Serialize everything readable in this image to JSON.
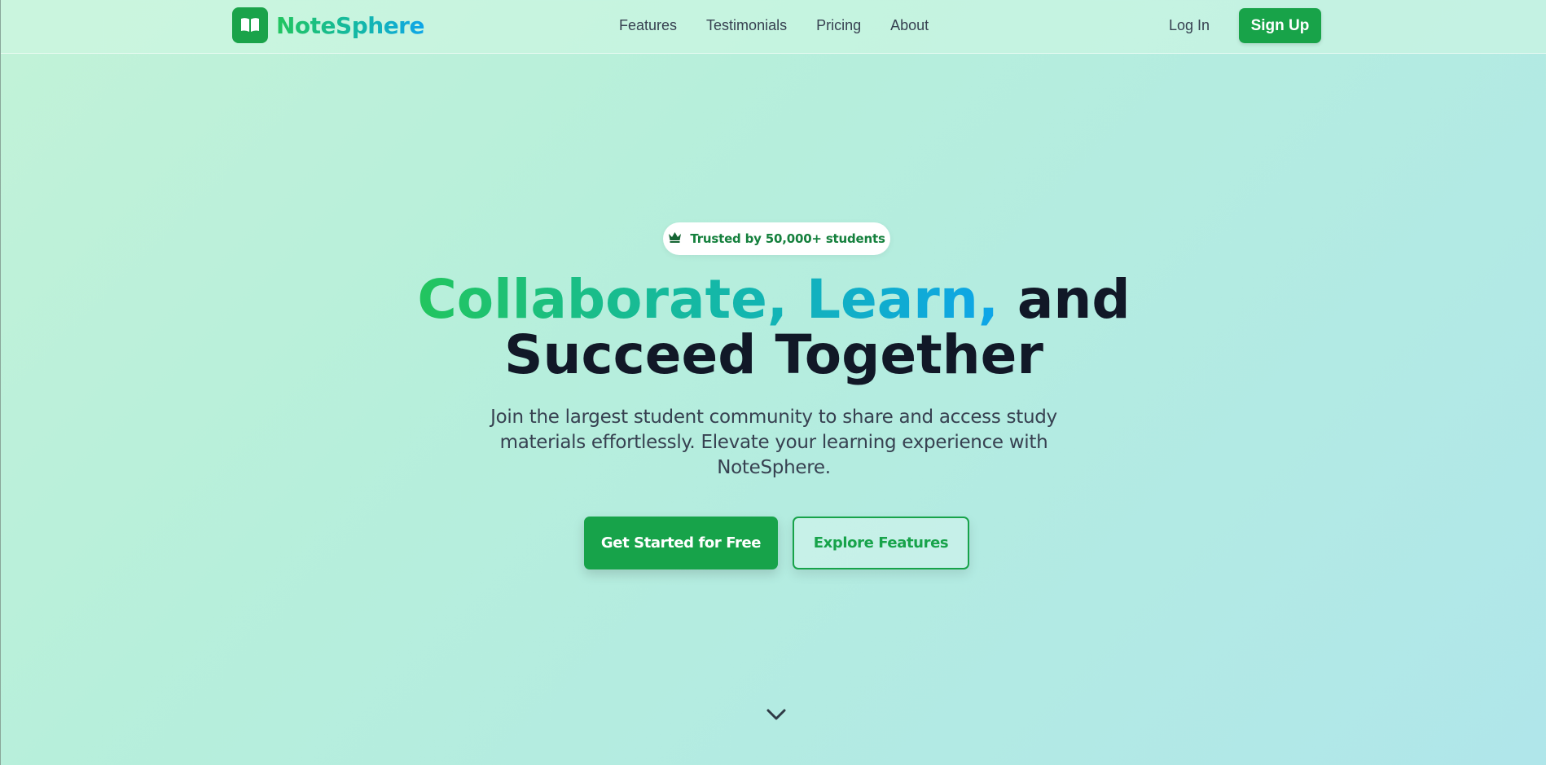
{
  "brand": {
    "name": "NoteSphere",
    "icon": "open-book-icon",
    "accent": "#18a349",
    "gradient": [
      "#22c55e",
      "#14b8a6",
      "#0ea5e9"
    ]
  },
  "nav": {
    "links": [
      "Features",
      "Testimonials",
      "Pricing",
      "About"
    ],
    "login_label": "Log In",
    "signup_label": "Sign Up"
  },
  "hero": {
    "badge": {
      "icon": "crown-icon",
      "text": "Trusted by 50,000+ students"
    },
    "headline": {
      "highlight": "Collaborate, Learn,",
      "rest_line1": " and",
      "line2": "Succeed Together"
    },
    "subtitle": "Join the largest student community to share and access study materials effortlessly. Elevate your learning experience with NoteSphere.",
    "primary_cta": "Get Started for Free",
    "secondary_cta": "Explore Features",
    "scroll_icon": "chevron-down-icon"
  }
}
